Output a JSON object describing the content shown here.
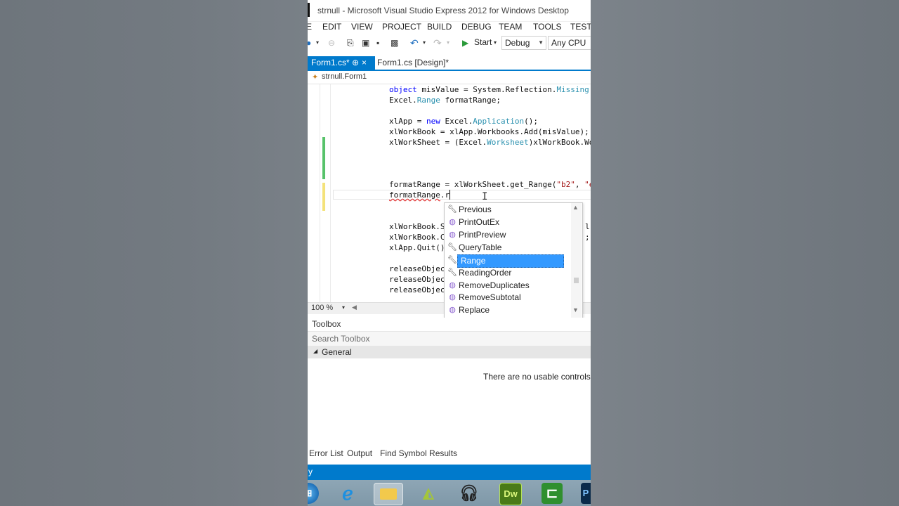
{
  "window": {
    "title": "strnull - Microsoft Visual Studio Express 2012 for Windows Desktop"
  },
  "menu": [
    "E",
    "EDIT",
    "VIEW",
    "PROJECT",
    "BUILD",
    "DEBUG",
    "TEAM",
    "TOOLS",
    "TEST"
  ],
  "toolbar": {
    "start_label": "Start",
    "config": "Debug",
    "platform": "Any CPU"
  },
  "tabs": [
    {
      "label": "Form1.cs*",
      "pin": "⊕",
      "close": "×"
    },
    {
      "label": "Form1.cs [Design]*"
    }
  ],
  "navbar": {
    "label": "strnull.Form1"
  },
  "code": {
    "l1": {
      "a": "object",
      "b": " misValue = System.Reflection.",
      "c": "Missing",
      "d": "."
    },
    "l2": {
      "a": "Excel.",
      "b": "Range",
      "c": " formatRange;"
    },
    "l3": {
      "a": "xlApp = ",
      "b": "new",
      "c": " Excel.",
      "d": "Application",
      "e": "();"
    },
    "l4": {
      "a": "xlWorkBook = xlApp.Workbooks.Add(misValue);"
    },
    "l5": {
      "a": "xlWorkSheet = (Excel.",
      "b": "Worksheet",
      "c": ")xlWorkBook.Wo"
    },
    "l6": {
      "a": "formatRange = xlWorkSheet.get_Range(",
      "b": "\"b2\"",
      "c": ", ",
      "d": "\"e"
    },
    "l7": {
      "a": "formatRange",
      "b": ".r"
    },
    "l8": {
      "a": "xlWorkBook.S",
      "b": "l."
    },
    "l9": {
      "a": "xlWorkBook.C",
      "b": ";"
    },
    "l10": {
      "a": "xlApp.Quit()"
    },
    "l11": {
      "a": "releaseObjec"
    },
    "l12": {
      "a": "releaseObjec"
    },
    "l13": {
      "a": "releaseObjec"
    }
  },
  "completion": {
    "items": [
      {
        "label": "Previous",
        "icon": "wrench-icon"
      },
      {
        "label": "PrintOutEx",
        "icon": "method-icon"
      },
      {
        "label": "PrintPreview",
        "icon": "method-icon"
      },
      {
        "label": "QueryTable",
        "icon": "wrench-icon"
      },
      {
        "label": "Range",
        "icon": "wrench-icon",
        "selected": true
      },
      {
        "label": "ReadingOrder",
        "icon": "wrench-icon"
      },
      {
        "label": "RemoveDuplicates",
        "icon": "method-icon"
      },
      {
        "label": "RemoveSubtotal",
        "icon": "method-icon"
      },
      {
        "label": "Replace",
        "icon": "method-icon"
      }
    ]
  },
  "zoom": "100 %",
  "toolbox": {
    "title": "Toolbox",
    "search_placeholder": "Search Toolbox",
    "group": "General",
    "empty_message": "There are no usable controls in"
  },
  "bottom_tabs": [
    "Error List",
    "Output",
    "Find Symbol Results"
  ],
  "status": {
    "text": "y"
  },
  "taskbar": {
    "icons": [
      "windows-start-icon",
      "internet-explorer-icon",
      "file-explorer-icon",
      "android-studio-icon",
      "audio-player-icon",
      "dreamweaver-icon",
      "camtasia-icon",
      "photoshop-icon"
    ],
    "dw_label": "Dw",
    "ps_label": "P"
  },
  "colors": {
    "accent": "#007acc",
    "keyword": "#0000ff",
    "type": "#2b91af",
    "string": "#a31515",
    "selection": "#3399ff"
  }
}
